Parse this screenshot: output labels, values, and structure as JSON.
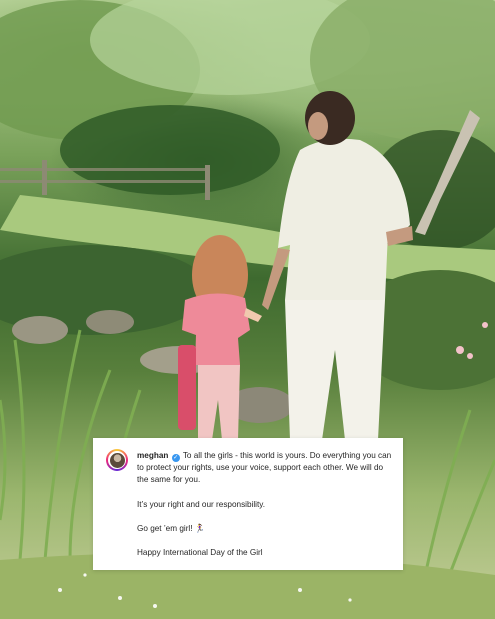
{
  "post": {
    "username": "meghan",
    "caption_line1": "To all the girls - this world is yours. Do everything you can to protect your rights, use your voice, support each other. We will do the same for you.",
    "caption_line2": "It’s your right and our responsibility.",
    "caption_line3": "Go get ’em girl!",
    "caption_emoji": "🏃‍♀️",
    "caption_line4": "Happy International Day of the Girl"
  },
  "icons": {
    "verified": "verified-badge-icon",
    "avatar": "profile-avatar"
  },
  "colors": {
    "verified": "#3897f0",
    "text": "#262626",
    "card": "#ffffff"
  }
}
